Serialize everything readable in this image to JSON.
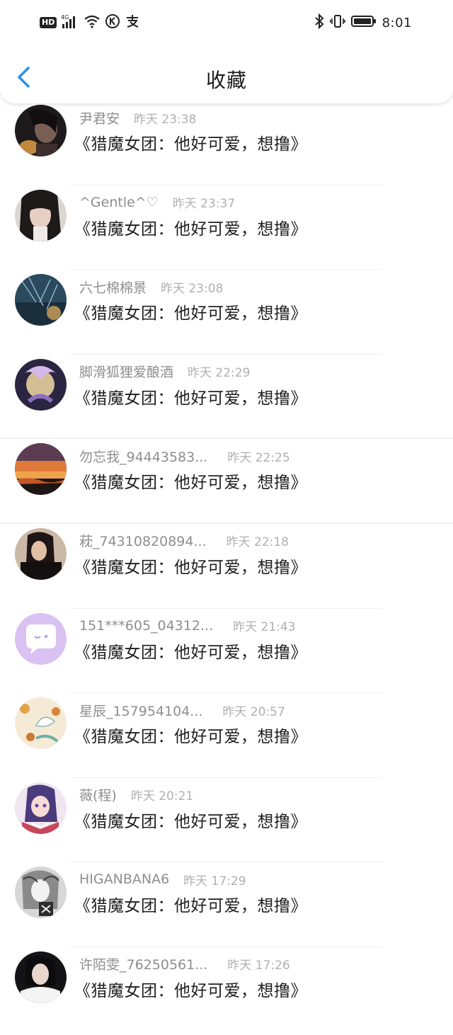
{
  "status_bar": {
    "network_badge": "HD",
    "network_type": "4G",
    "time": "8:01",
    "icons": [
      "signal-icon",
      "wifi-icon",
      "k-app-icon",
      "alipay-icon",
      "bluetooth-icon",
      "vibrate-icon",
      "battery-icon"
    ]
  },
  "header": {
    "title": "收藏",
    "back_icon": "chevron-left-icon",
    "accent": "#2f8fe8"
  },
  "items": [
    {
      "user": "尹君安",
      "time": "昨天 23:38",
      "content": "《猎魔女团：他好可爱，想撸》",
      "avatar": "dark-portrait"
    },
    {
      "user": "^Gentle^♡",
      "time": "昨天 23:37",
      "content": "《猎魔女团：他好可爱，想撸》",
      "avatar": "girl-selfie"
    },
    {
      "user": "六七棉棉景",
      "time": "昨天 23:08",
      "content": "《猎魔女团：他好可爱，想撸》",
      "avatar": "blue-night-tree"
    },
    {
      "user": "脚滑狐狸爱酿酒",
      "time": "昨天 22:29",
      "content": "《猎魔女团：他好可爱，想撸》",
      "avatar": "anime-glow"
    },
    {
      "user": "勿忘我_94443583...",
      "time": "昨天 22:25",
      "content": "《猎魔女团：他好可爱，想撸》",
      "avatar": "sunset"
    },
    {
      "user": "萙_74310820894...",
      "time": "昨天 22:18",
      "content": "《猎魔女团：他好可爱，想撸》",
      "avatar": "dark-person"
    },
    {
      "user": "151***605_04312...",
      "time": "昨天 21:43",
      "content": "《猎魔女团：他好可爱，想撸》",
      "avatar": "default-chat-bubble"
    },
    {
      "user": "星辰_157954104...",
      "time": "昨天 20:57",
      "content": "《猎魔女团：他好可爱，想撸》",
      "avatar": "illustration-leaves"
    },
    {
      "user": "薇(程)",
      "time": "昨天 20:21",
      "content": "《猎魔女团：他好可爱，想撸》",
      "avatar": "anime-girl-purple"
    },
    {
      "user": "HIGANBANA6",
      "time": "昨天 17:29",
      "content": "《猎魔女团：他好可爱，想撸》",
      "avatar": "sketch-portrait"
    },
    {
      "user": "许陌雯_76250561...",
      "time": "昨天 17:26",
      "content": "《猎魔女团：他好可爱，想撸》",
      "avatar": "girl-white-shirt"
    }
  ]
}
